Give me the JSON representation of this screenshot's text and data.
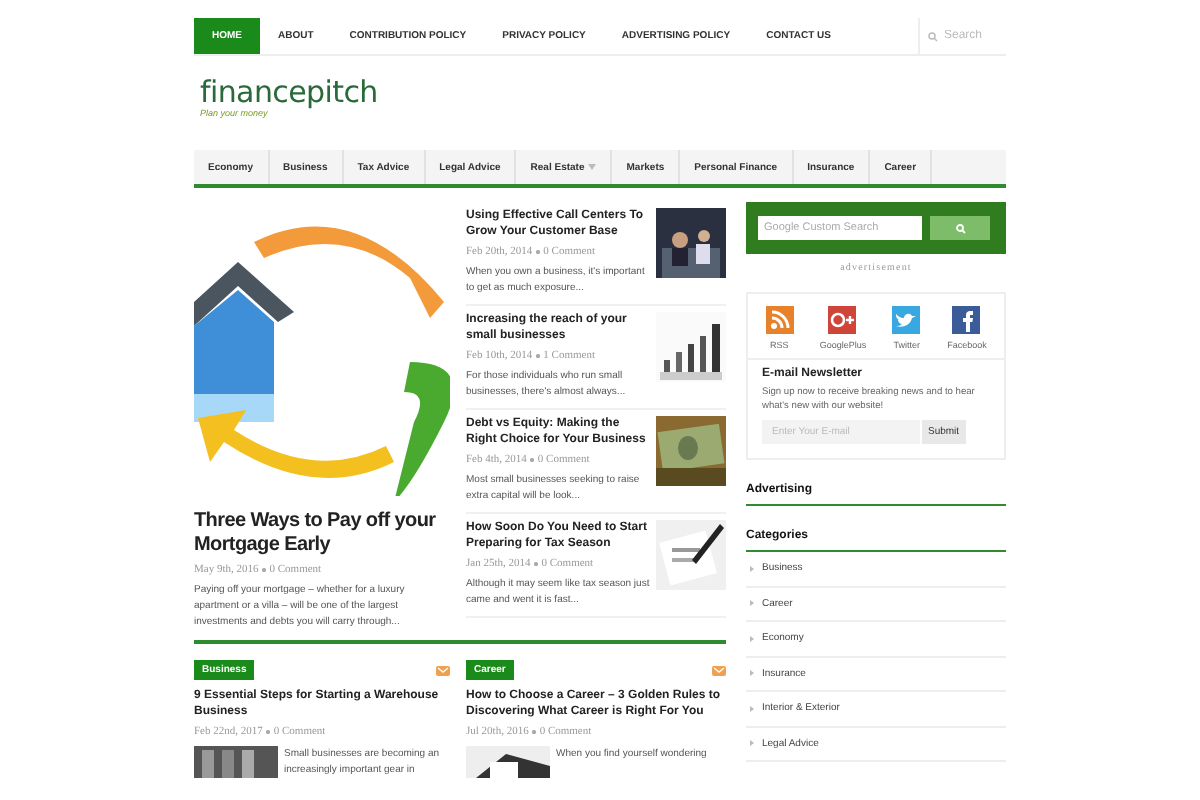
{
  "top_nav": {
    "items": [
      {
        "label": "HOME",
        "selected": true
      },
      {
        "label": "ABOUT",
        "selected": false
      },
      {
        "label": "CONTRIBUTION POLICY",
        "selected": false
      },
      {
        "label": "PRIVACY POLICY",
        "selected": false
      },
      {
        "label": "ADVERTISING POLICY",
        "selected": false
      },
      {
        "label": "CONTACT US",
        "selected": false
      }
    ],
    "search": {
      "placeholder": "Search"
    }
  },
  "logo": {
    "name": "financepitch",
    "tagline": "Plan your money"
  },
  "category_nav": [
    {
      "label": "Economy",
      "has_submenu": false
    },
    {
      "label": "Business",
      "has_submenu": false
    },
    {
      "label": "Tax Advice",
      "has_submenu": false
    },
    {
      "label": "Legal Advice",
      "has_submenu": false
    },
    {
      "label": "Real Estate",
      "has_submenu": true
    },
    {
      "label": "Markets",
      "has_submenu": false
    },
    {
      "label": "Personal Finance",
      "has_submenu": false
    },
    {
      "label": "Insurance",
      "has_submenu": false
    },
    {
      "label": "Career",
      "has_submenu": false
    }
  ],
  "featured": {
    "title": "Three Ways to Pay off your Mortgage Early",
    "date": "May 9th, 2016",
    "comments": "0 Comment",
    "excerpt": "Paying off your mortgage – whether for a luxury apartment or a villa – will be one of the largest investments and debts you will carry through..."
  },
  "side_posts": [
    {
      "title": "Using Effective Call Centers To Grow Your Customer Base",
      "date": "Feb 20th, 2014",
      "comments": "0 Comment",
      "excerpt": "When you own a business, it's important to get as much exposure..."
    },
    {
      "title": "Increasing the reach of your small businesses",
      "date": "Feb 10th, 2014",
      "comments": "1 Comment",
      "excerpt": "For those individuals who run small businesses, there's almost always..."
    },
    {
      "title": "Debt vs Equity: Making the Right Choice for Your Business",
      "date": "Feb 4th, 2014",
      "comments": "0 Comment",
      "excerpt": "Most small businesses seeking to raise extra capital will be look..."
    },
    {
      "title": "How Soon Do You Need to Start Preparing for Tax Season",
      "date": "Jan 25th, 2014",
      "comments": "0 Comment",
      "excerpt": "Although it may seem like tax season just came and went it is fast..."
    }
  ],
  "sections": [
    {
      "category": "Business",
      "title": "9 Essential Steps for Starting a Warehouse Business",
      "date": "Feb 22nd, 2017",
      "comments": "0 Comment",
      "excerpt": "Small businesses are becoming an increasingly important gear in"
    },
    {
      "category": "Career",
      "title": "How to Choose a Career – 3 Golden Rules to Discovering What Career is Right For You",
      "date": "Jul 20th, 2016",
      "comments": "0 Comment",
      "excerpt": "When you find yourself wondering"
    }
  ],
  "sidebar": {
    "search": {
      "placeholder": "Google Custom Search"
    },
    "ad_label": "advertisement",
    "social": [
      {
        "kind": "rss",
        "label": "RSS"
      },
      {
        "kind": "googleplus",
        "label": "GooglePlus"
      },
      {
        "kind": "twitter",
        "label": "Twitter"
      },
      {
        "kind": "facebook",
        "label": "Facebook"
      }
    ],
    "newsletter": {
      "title": "E-mail Newsletter",
      "text": "Sign up now to receive breaking news and to hear what's new with our website!",
      "placeholder": "Enter Your E-mail",
      "button": "Submit"
    },
    "headings": [
      "Advertising",
      "Categories"
    ],
    "categories": [
      "Business",
      "Career",
      "Economy",
      "Insurance",
      "Interior & Exterior",
      "Legal Advice"
    ]
  }
}
